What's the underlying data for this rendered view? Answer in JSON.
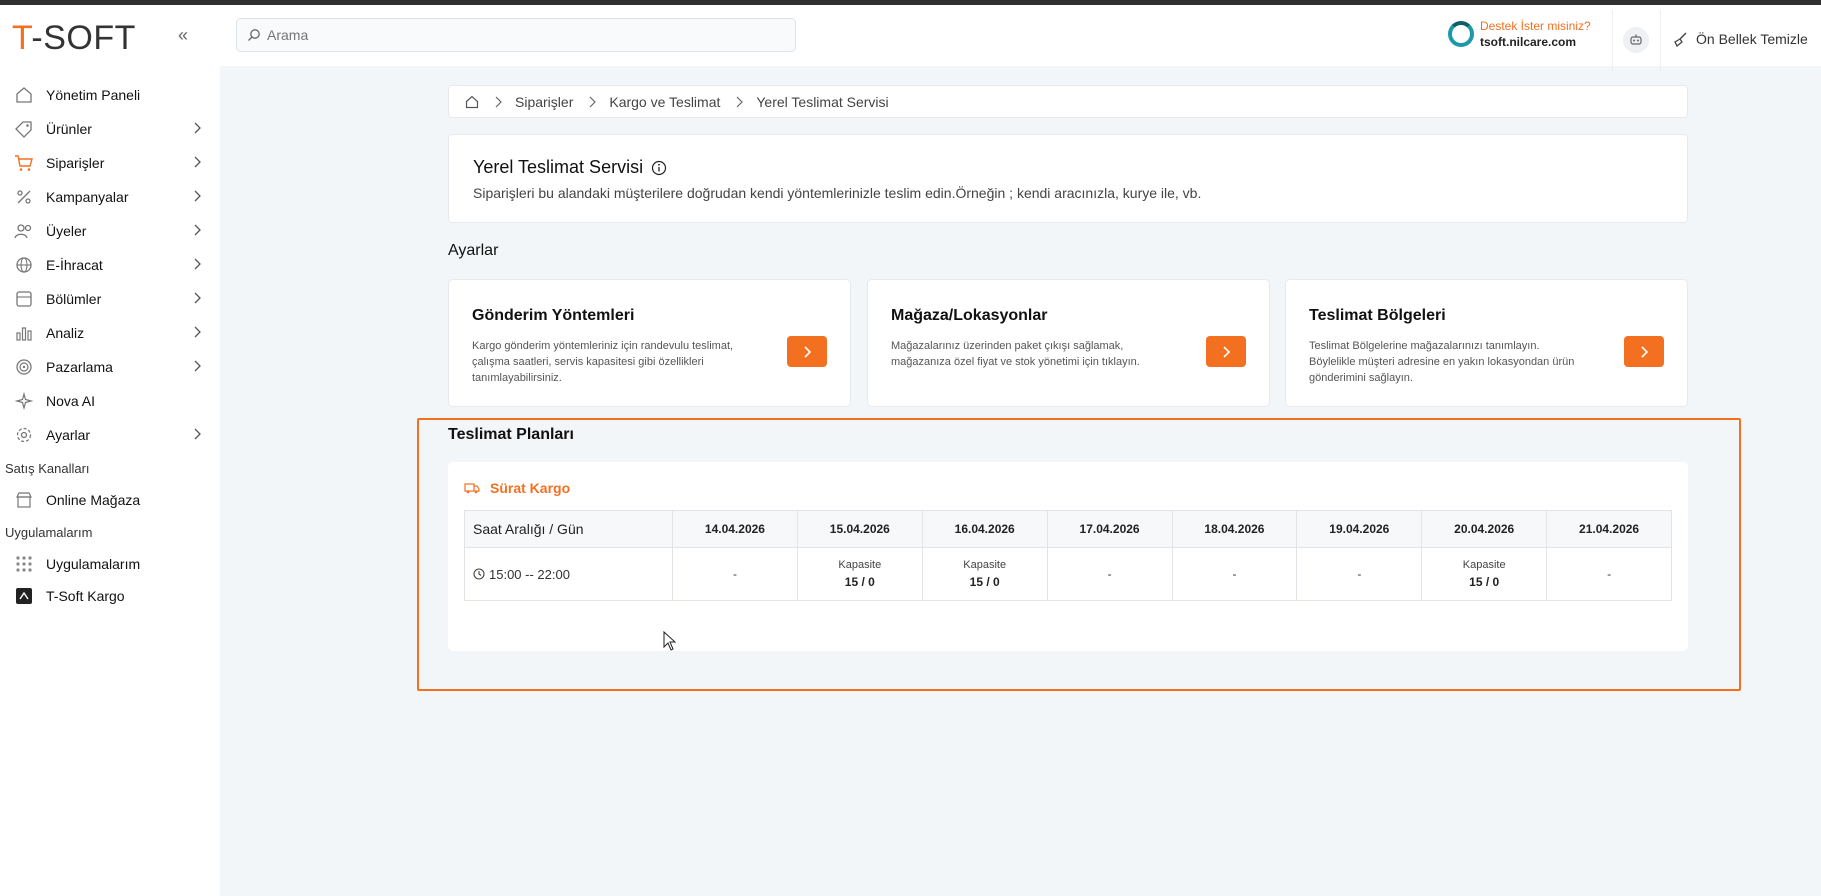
{
  "header": {
    "logo_first": "T",
    "logo_rest": "-SOFT",
    "search_placeholder": "Arama",
    "support_question": "Destek İster misiniz?",
    "support_url": "tsoft.nilcare.com",
    "cache_label": "Ön Bellek Temizle"
  },
  "sidebar": {
    "items": [
      {
        "label": "Yönetim Paneli",
        "icon": "home-icon"
      },
      {
        "label": "Ürünler",
        "icon": "tag-icon"
      },
      {
        "label": "Siparişler",
        "icon": "cart-icon"
      },
      {
        "label": "Kampanyalar",
        "icon": "discount-icon"
      },
      {
        "label": "Üyeler",
        "icon": "users-icon"
      },
      {
        "label": "E-İhracat",
        "icon": "globe-icon"
      },
      {
        "label": "Bölümler",
        "icon": "sections-icon"
      },
      {
        "label": "Analiz",
        "icon": "chart-icon"
      },
      {
        "label": "Pazarlama",
        "icon": "target-icon"
      },
      {
        "label": "Nova AI",
        "icon": "sparkle-icon"
      },
      {
        "label": "Ayarlar",
        "icon": "gear-icon"
      }
    ],
    "section_sales": "Satış Kanalları",
    "online_store": "Online Mağaza",
    "section_apps": "Uygulamalarım",
    "apps": "Uygulamalarım",
    "tsoft_kargo": "T-Soft Kargo"
  },
  "breadcrumb": [
    "Siparişler",
    "Kargo ve Teslimat",
    "Yerel Teslimat Servisi"
  ],
  "info": {
    "title": "Yerel Teslimat Servisi",
    "description": "Siparişleri bu alandaki müşterilere doğrudan kendi yöntemlerinizle teslim edin.Örneğin ; kendi aracınızla, kurye ile, vb."
  },
  "settings": {
    "title": "Ayarlar",
    "cards": [
      {
        "title": "Gönderim Yöntemleri",
        "desc": "Kargo gönderim yöntemleriniz için randevulu teslimat, çalışma saatleri, servis kapasitesi gibi özellikleri tanımlayabilirsiniz."
      },
      {
        "title": "Mağaza/Lokasyonlar",
        "desc": "Mağazalarınız üzerinden paket çıkışı sağlamak, mağazanıza özel fiyat ve stok yönetimi için tıklayın."
      },
      {
        "title": "Teslimat Bölgeleri",
        "desc": "Teslimat Bölgelerine mağazalarınızı tanımlayın. Böylelikle müşteri adresine en yakın lokasyondan ürün gönderimini sağlayın."
      }
    ]
  },
  "plans": {
    "title": "Teslimat Planları",
    "carrier": "Sürat Kargo",
    "header_first": "Saat Aralığı / Gün",
    "dates": [
      "14.04.2026",
      "15.04.2026",
      "16.04.2026",
      "17.04.2026",
      "18.04.2026",
      "19.04.2026",
      "20.04.2026",
      "21.04.2026"
    ],
    "row": {
      "time": "15:00 -- 22:00",
      "cells": [
        {
          "type": "empty",
          "text": "-"
        },
        {
          "type": "cap",
          "label": "Kapasite",
          "value": "15 / 0"
        },
        {
          "type": "cap",
          "label": "Kapasite",
          "value": "15 / 0"
        },
        {
          "type": "empty",
          "text": "-"
        },
        {
          "type": "empty",
          "text": "-"
        },
        {
          "type": "empty",
          "text": "-"
        },
        {
          "type": "cap",
          "label": "Kapasite",
          "value": "15 / 0"
        },
        {
          "type": "empty",
          "text": "-"
        }
      ]
    }
  },
  "colors": {
    "accent": "#f37021",
    "background": "#f3f6f9"
  }
}
